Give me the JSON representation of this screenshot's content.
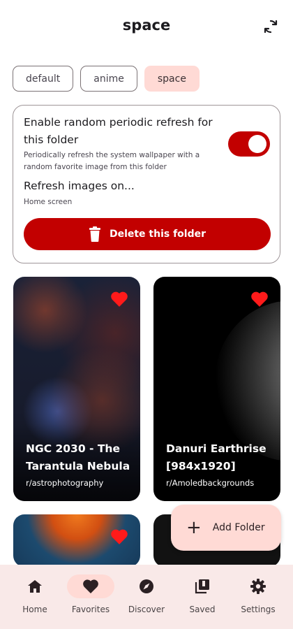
{
  "header": {
    "title": "space",
    "refresh_icon": "refresh-icon"
  },
  "chips": [
    {
      "label": "default",
      "selected": false
    },
    {
      "label": "anime",
      "selected": false
    },
    {
      "label": "space",
      "selected": true
    }
  ],
  "folder_settings": {
    "random_refresh_title": "Enable random periodic refresh for this folder",
    "random_refresh_desc": "Periodically refresh the system wallpaper with a random favorite image from this folder",
    "random_refresh_enabled": true,
    "refresh_on_label": "Refresh images on...",
    "refresh_on_value": "Home screen",
    "delete_label": "Delete this folder",
    "delete_icon": "trash-icon"
  },
  "wallpapers": [
    {
      "title": "NGC 2030 - The Tarantula Nebula",
      "subreddit": "r/astrophotography",
      "favorited": true
    },
    {
      "title": "Danuri Earthrise [984x1920]",
      "subreddit": "r/Amoledbackgrounds",
      "favorited": true
    },
    {
      "title": "",
      "subreddit": "",
      "favorited": true
    },
    {
      "title": "",
      "subreddit": "",
      "favorited": false
    }
  ],
  "fab": {
    "label": "Add Folder",
    "icon": "plus-icon"
  },
  "nav": {
    "items": [
      {
        "label": "Home",
        "icon": "home-icon",
        "active": false
      },
      {
        "label": "Favorites",
        "icon": "heart-icon",
        "active": true
      },
      {
        "label": "Discover",
        "icon": "compass-icon",
        "active": false
      },
      {
        "label": "Saved",
        "icon": "library-icon",
        "active": false
      },
      {
        "label": "Settings",
        "icon": "gear-icon",
        "active": false
      }
    ]
  },
  "colors": {
    "accent": "#c20000",
    "chip_selected": "#ffdad5",
    "navbar_bg": "#f9e9e8"
  }
}
